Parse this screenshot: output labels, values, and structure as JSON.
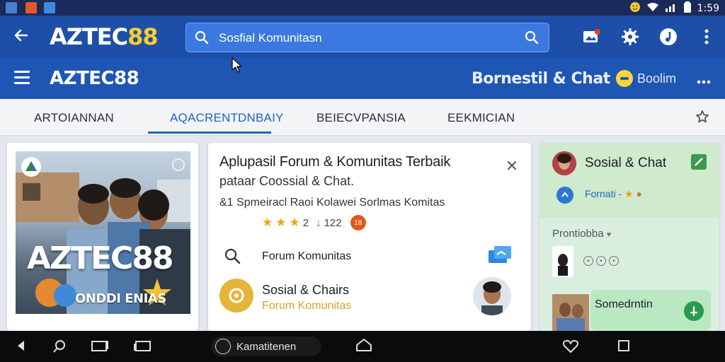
{
  "status_bar": {
    "time": "1:59"
  },
  "app_bar": {
    "brand": "AZTEC",
    "brand_suffix": "88",
    "search_value": "Sosfial Komunitasn"
  },
  "sub_bar": {
    "title": "AZTEC88",
    "right_title": "Bornestil & Chat",
    "badge_label": "Boolim"
  },
  "tabs": [
    {
      "label": "ARTOIANNAN"
    },
    {
      "label": "AQACRENTDNBAIY"
    },
    {
      "label": "BEIECVPANSIA"
    },
    {
      "label": "EEKMICIAN"
    }
  ],
  "promo": {
    "title": "AZTEC88",
    "subtitle": "ONDDI ENIAS"
  },
  "mid_card": {
    "title": "Aplupasil Forum & Komunitas Terbaik",
    "subtitle": "pataar Coossial & Chat.",
    "description": "&1 Spmeiracl Raoi Kolawei Sorlmas Komitas",
    "rating_value": "2",
    "rating_count": "122",
    "row1_label": "Forum Komunitas",
    "row2_title": "Sosial & Chairs",
    "row2_subtitle": "Forum Komunitas"
  },
  "right_panel": {
    "title": "Sosial & Chat",
    "subtitle": "Fornati -",
    "section_label": "Prontiobba",
    "card_label": "Somedrntin"
  },
  "nav_bar": {
    "pill_label": "Kamatitenen"
  },
  "colors": {
    "app_bar": "#1d4fa8",
    "sub_bar": "#1f56b4",
    "accent": "#1d63c9",
    "brand_yellow": "#ffcc2e"
  }
}
